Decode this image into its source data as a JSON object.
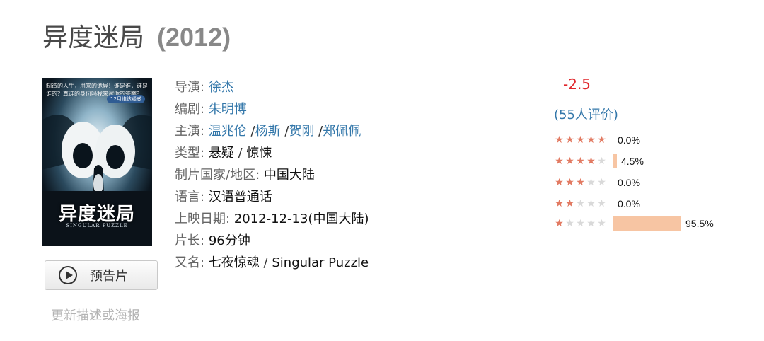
{
  "movie": {
    "title": "异度迷局",
    "year": "(2012)"
  },
  "poster": {
    "title_cn": "异度迷局",
    "title_en": "SINGULAR  PUZZLE",
    "tagline": "制造的人生，用来的诡异！谁是谁，谁是谁的？真谁的身份吗我来试你的答案？",
    "badge": "12月谁该疑惑"
  },
  "trailer_button": {
    "label": "预告片",
    "icon": "play-circle-icon"
  },
  "update_link": "更新描述或海报",
  "info": {
    "director": {
      "label": "导演:",
      "names": [
        "徐杰"
      ]
    },
    "writer": {
      "label": "编剧:",
      "names": [
        "朱明博"
      ]
    },
    "cast": {
      "label": "主演:",
      "names": [
        "温兆伦",
        "杨斯",
        "贺刚",
        "郑佩佩"
      ]
    },
    "genre": {
      "label": "类型:",
      "values": [
        "悬疑",
        "惊悚"
      ]
    },
    "country": {
      "label": "制片国家/地区:",
      "value": "中国大陆"
    },
    "language": {
      "label": "语言:",
      "value": "汉语普通话"
    },
    "release": {
      "label": "上映日期:",
      "value": "2012-12-13(中国大陆)"
    },
    "runtime": {
      "label": "片长:",
      "value": "96分钟"
    },
    "aka": {
      "label": "又名:",
      "values": [
        "七夜惊魂",
        "Singular Puzzle"
      ]
    }
  },
  "rating": {
    "score": "-2.5",
    "count_text": "(55人评价)",
    "distribution": [
      {
        "stars": 5,
        "percent_text": "0.0%",
        "fraction": 0.0
      },
      {
        "stars": 4,
        "percent_text": "4.5%",
        "fraction": 0.045
      },
      {
        "stars": 3,
        "percent_text": "0.0%",
        "fraction": 0.0
      },
      {
        "stars": 2,
        "percent_text": "0.0%",
        "fraction": 0.0
      },
      {
        "stars": 1,
        "percent_text": "95.5%",
        "fraction": 0.955
      }
    ]
  },
  "colors": {
    "link": "#3377aa",
    "score": "#e0252a",
    "star": "#e27a62",
    "bar": "#f7c5a3"
  }
}
